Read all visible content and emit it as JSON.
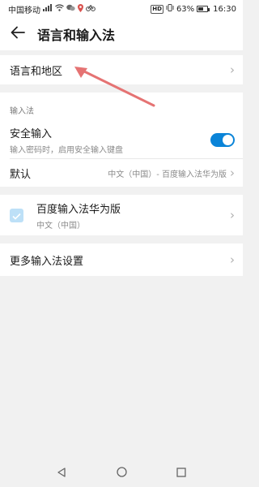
{
  "status_bar": {
    "carrier": "中国移动",
    "hd_badge": "HD",
    "battery": "63%",
    "time": "16:30",
    "battery_level": 0.63
  },
  "app_bar": {
    "title": "语言和输入法",
    "back_icon": "arrow-left-icon"
  },
  "language_region": {
    "label": "语言和地区"
  },
  "input_methods": {
    "section_title": "输入法",
    "secure_input": {
      "title": "安全输入",
      "subtitle": "输入密码时，启用安全输入键盘",
      "enabled": true
    },
    "default": {
      "title": "默认",
      "value": "中文（中国）- 百度输入法华为版"
    }
  },
  "keyboard": {
    "title": "百度输入法华为版",
    "subtitle": "中文（中国）",
    "checked": true
  },
  "more_settings": {
    "label": "更多输入法设置"
  },
  "colors": {
    "accent": "#0a84d8",
    "annotation_arrow": "#e57373",
    "checkbox_fill": "#bde0f7"
  }
}
